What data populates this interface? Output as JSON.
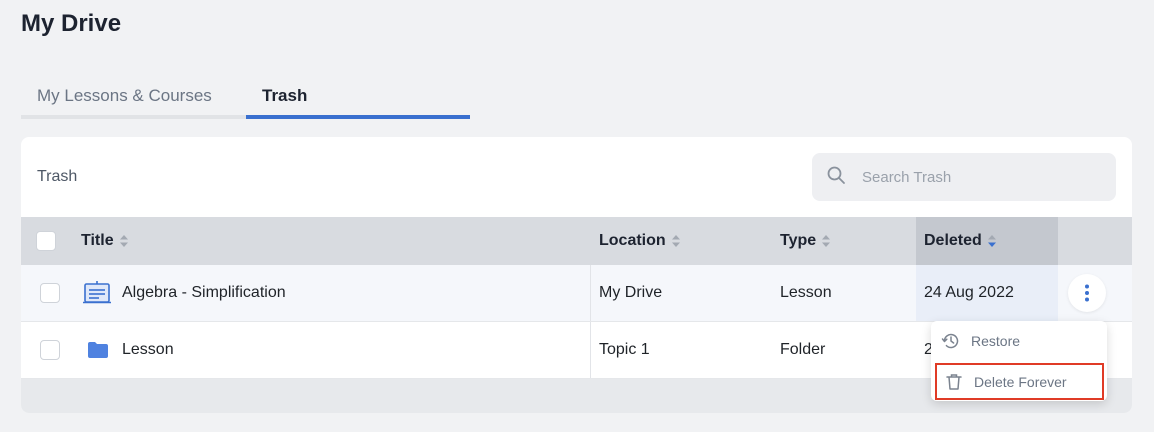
{
  "page": {
    "title": "My Drive"
  },
  "tabs": [
    {
      "label": "My Lessons & Courses",
      "active": false
    },
    {
      "label": "Trash",
      "active": true
    }
  ],
  "panel": {
    "heading": "Trash",
    "search": {
      "placeholder": "Search Trash",
      "value": ""
    }
  },
  "table": {
    "columns": [
      {
        "label": "Title",
        "sort": "none"
      },
      {
        "label": "Location",
        "sort": "none"
      },
      {
        "label": "Type",
        "sort": "none"
      },
      {
        "label": "Deleted",
        "sort": "desc"
      }
    ],
    "rows": [
      {
        "icon": "lesson-board-icon",
        "title": "Algebra - Simplification",
        "location": "My Drive",
        "type": "Lesson",
        "deleted": "24 Aug 2022"
      },
      {
        "icon": "folder-icon",
        "title": "Lesson",
        "location": "Topic 1",
        "type": "Folder",
        "deleted": "2"
      }
    ]
  },
  "context_menu": {
    "items": [
      {
        "label": "Restore",
        "icon": "restore-icon"
      },
      {
        "label": "Delete Forever",
        "icon": "trash-icon"
      }
    ]
  },
  "colors": {
    "accent": "#3a70cf",
    "highlight_border": "#e03b26",
    "header_bg": "#d8dbe0",
    "page_bg": "#f1f2f4"
  }
}
